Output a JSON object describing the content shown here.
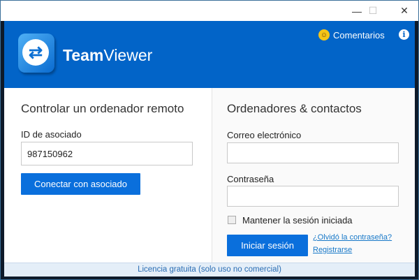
{
  "window": {
    "minimize": "—",
    "maximize": "☐",
    "close": "✕"
  },
  "header": {
    "brand_bold": "Team",
    "brand_light": "Viewer",
    "feedback": "Comentarios",
    "info": "i"
  },
  "remote": {
    "title": "Controlar un ordenador remoto",
    "id_label": "ID de asociado",
    "id_value": "987150962",
    "connect": "Conectar con asociado"
  },
  "contacts": {
    "title": "Ordenadores & contactos",
    "email_label": "Correo electrónico",
    "email_value": "",
    "password_label": "Contraseña",
    "password_value": "",
    "keep_session": "Mantener la sesión iniciada",
    "login": "Iniciar sesión",
    "forgot": "¿Olvidó la contraseña?",
    "register": "Registrarse"
  },
  "footer": {
    "license": "Licencia gratuita (solo uso no comercial)"
  }
}
